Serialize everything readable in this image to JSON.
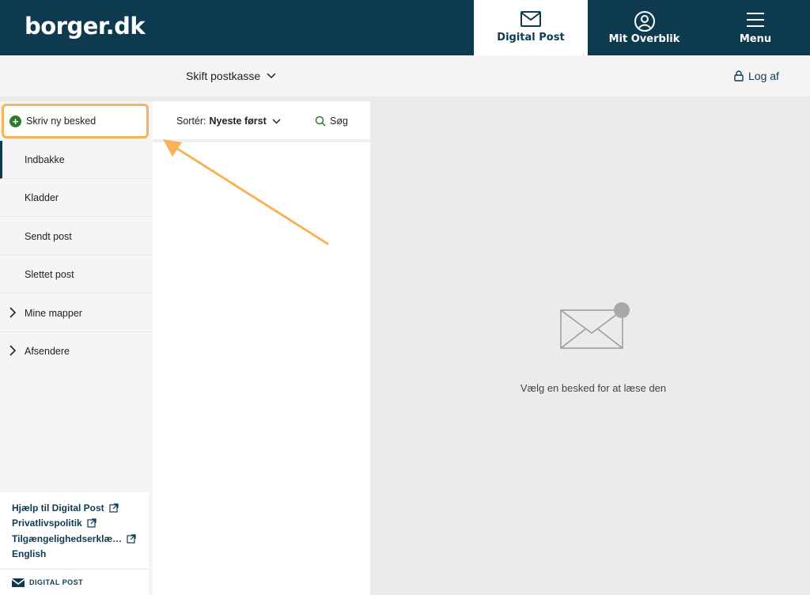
{
  "header": {
    "logo": "borger.dk",
    "nav": [
      {
        "label": "Digital Post",
        "active": true
      },
      {
        "label": "Mit Overblik",
        "active": false
      },
      {
        "label": "Menu",
        "active": false
      }
    ]
  },
  "subbar": {
    "switch_mailbox": "Skift postkasse",
    "logout": "Log af"
  },
  "sidebar": {
    "compose": "Skriv ny besked",
    "items": [
      {
        "label": "Indbakke"
      },
      {
        "label": "Kladder"
      },
      {
        "label": "Sendt post"
      },
      {
        "label": "Slettet post"
      },
      {
        "label": "Mine mapper"
      },
      {
        "label": "Afsendere"
      }
    ],
    "footer_links": [
      {
        "label": "Hjælp til Digital Post"
      },
      {
        "label": "Privatlivspolitik"
      },
      {
        "label": "Tilgængelighedserklæ…"
      },
      {
        "label": "English"
      }
    ],
    "brand": "DIGITAL POST"
  },
  "list": {
    "sort_label": "Sortér:",
    "sort_value": "Nyeste først",
    "search": "Søg"
  },
  "reading": {
    "empty_text": "Vælg en besked for at læse den"
  },
  "colors": {
    "header_bg": "#0e3a50",
    "highlight": "#f8b35a",
    "compose_plus": "#2d7a2d"
  }
}
